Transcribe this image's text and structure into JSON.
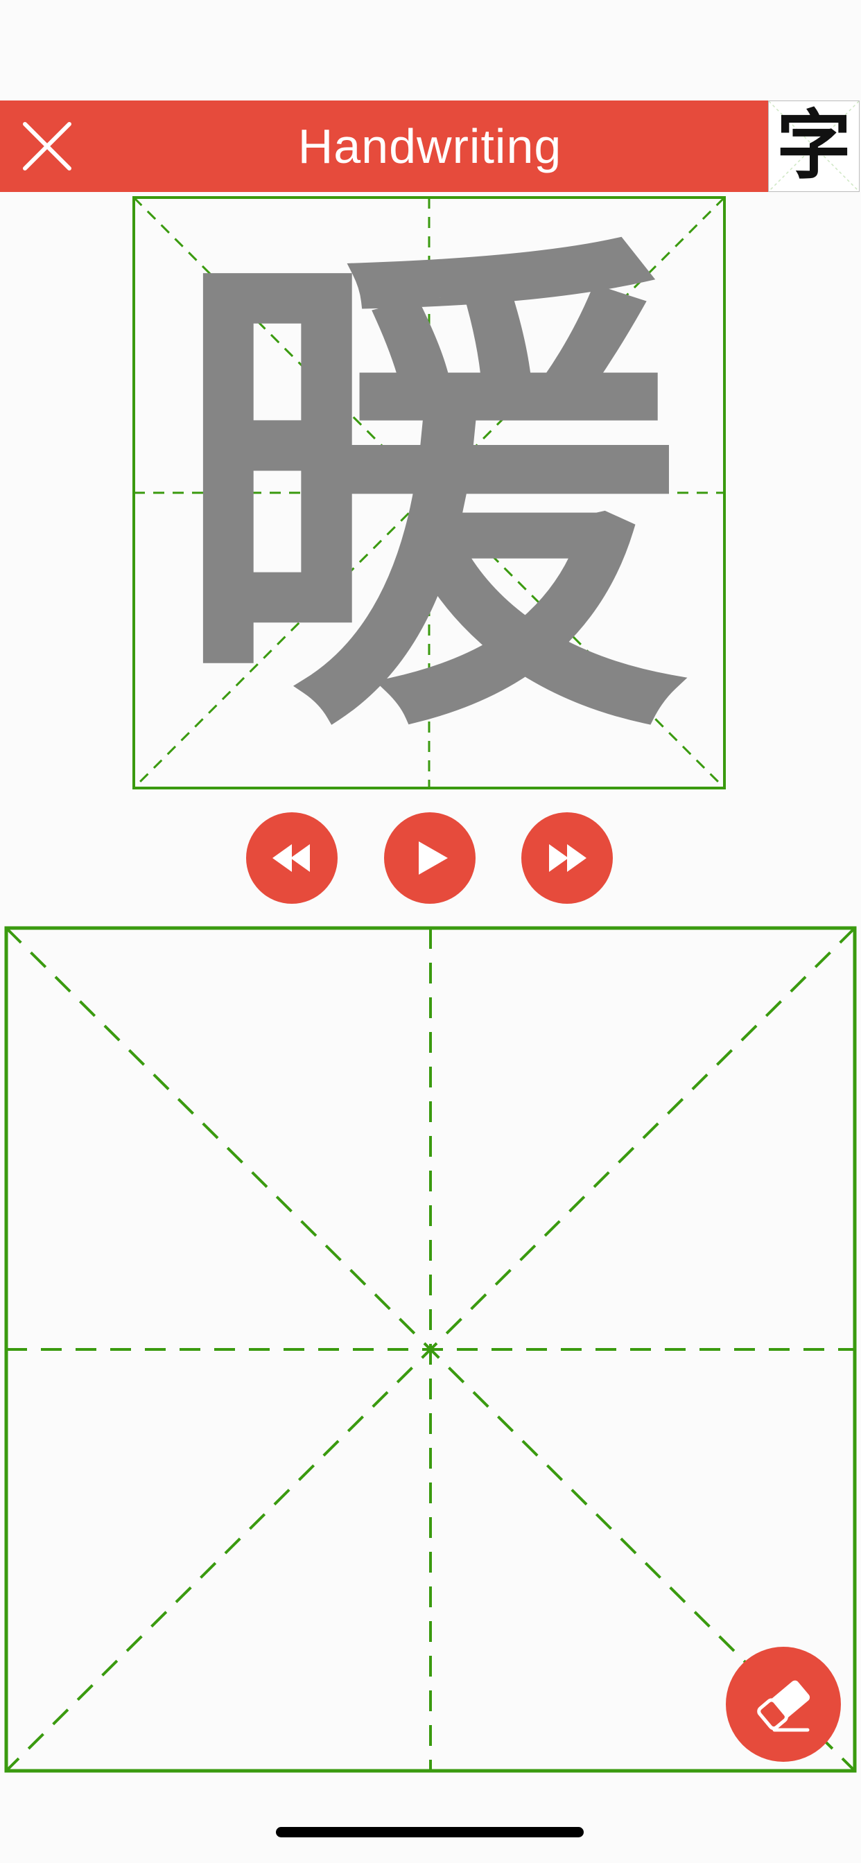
{
  "header": {
    "title": "Handwriting",
    "close_icon": "close-icon",
    "character_thumbnail": "字",
    "color": "#e64b3c"
  },
  "model": {
    "character": "暖",
    "grid_color": "#3a9a0f",
    "stroke_color": "#858585"
  },
  "controls": {
    "rewind_icon": "rewind-icon",
    "play_icon": "play-icon",
    "fast_forward_icon": "fast-forward-icon"
  },
  "pad": {
    "grid_color": "#3a9a0f"
  },
  "eraser": {
    "icon": "eraser-icon"
  }
}
